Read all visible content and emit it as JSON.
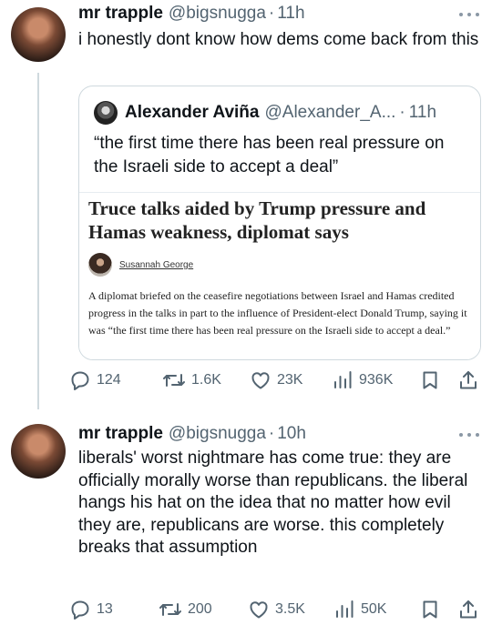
{
  "tweets": [
    {
      "name": "mr trapple",
      "handle": "@bigsnugga",
      "dot": "·",
      "time": "11h",
      "text": "i honestly dont know how dems come back from this",
      "quote": {
        "name": "Alexander Aviña",
        "handle": "@Alexander_A...",
        "dot": "·",
        "time": "11h",
        "text": "“the first time there has been real pressure on the Israeli side to accept a deal”",
        "article": {
          "title": "Truce talks aided by Trump pressure and Hamas weakness, diplomat says",
          "author": "Susannah George",
          "body": "A diplomat briefed on the ceasefire negotiations between Israel and Hamas credited progress in the talks in part to the influence of President-elect Donald Trump, saying it was “the first time there has been real pressure on the Israeli side to accept a deal.”"
        }
      },
      "actions": {
        "replies": "124",
        "reposts": "1.6K",
        "likes": "23K",
        "views": "936K"
      }
    },
    {
      "name": "mr trapple",
      "handle": "@bigsnugga",
      "dot": "·",
      "time": "10h",
      "text": "liberals' worst nightmare has come true: they are officially morally worse than republicans. the liberal hangs his hat on the idea that no matter how evil they are, republicans are worse. this completely breaks that assumption",
      "actions": {
        "replies": "13",
        "reposts": "200",
        "likes": "3.5K",
        "views": "50K"
      }
    }
  ],
  "icons": [
    "more-icon",
    "reply-icon",
    "repost-icon",
    "like-icon",
    "views-icon",
    "bookmark-icon",
    "share-icon"
  ],
  "colors": {
    "text": "#0f1419",
    "secondary": "#536471",
    "border": "#cfd9de"
  }
}
